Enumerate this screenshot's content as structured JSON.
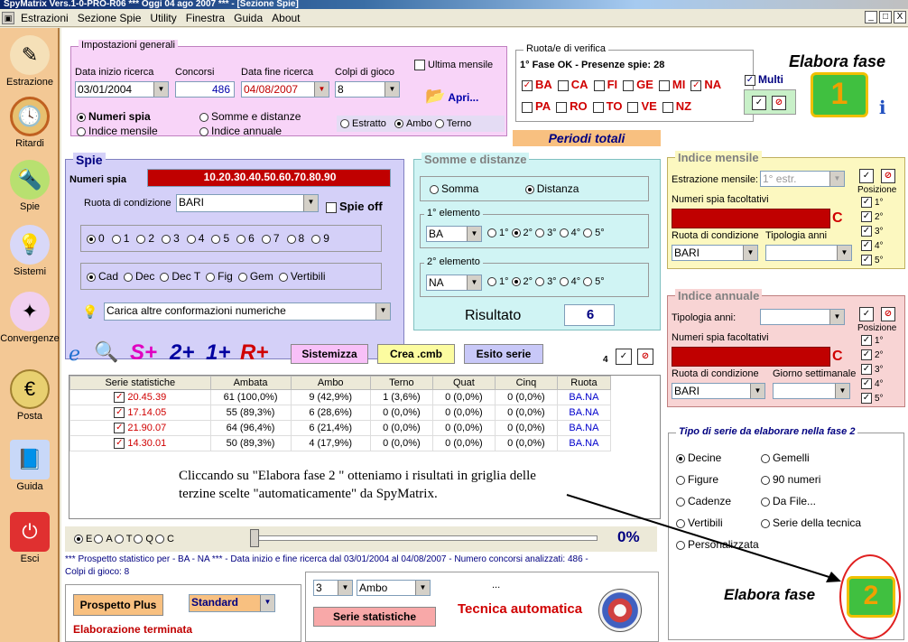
{
  "window": {
    "title": "SpyMatrix Vers.1-0-PRO-R06   ***   Oggi 04 ago 2007   ***   - [Sezione Spie]",
    "menu": [
      "Estrazioni",
      "Sezione Spie",
      "Utility",
      "Finestra",
      "Guida",
      "About"
    ],
    "controls": [
      "_",
      "□",
      "X"
    ]
  },
  "sidebar": [
    {
      "label": "Estrazione",
      "icon": "pencil-icon"
    },
    {
      "label": "Ritardi",
      "icon": "clock-icon"
    },
    {
      "label": "Spie",
      "icon": "flashlight-icon"
    },
    {
      "label": "Sistemi",
      "icon": "lightbulb-icon"
    },
    {
      "label": "Convergenze",
      "icon": "network-icon"
    },
    {
      "label": "Posta",
      "icon": "coin-icon"
    },
    {
      "label": "Guida",
      "icon": "book-icon"
    },
    {
      "label": "Esci",
      "icon": "power-icon"
    }
  ],
  "impostazioni": {
    "title": "Impostazioni generali",
    "data_inizio_label": "Data inizio ricerca",
    "data_inizio": "03/01/2004",
    "concorsi_label": "Concorsi",
    "concorsi": "486",
    "data_fine_label": "Data fine ricerca",
    "data_fine": "04/08/2007",
    "colpi_label": "Colpi di gioco",
    "colpi": "8",
    "ultima_mensile": "Ultima mensile",
    "apri": "Apri...",
    "modes": [
      "Numeri spia",
      "Indice mensile",
      "Somme e distanze",
      "Indice annuale"
    ],
    "sorte": [
      "Estratto",
      "Ambo",
      "Terno"
    ]
  },
  "ruote": {
    "title": "Ruota/e di verifica",
    "status": "1° Fase OK - Presenze spie: 28",
    "row1": [
      {
        "name": "BA",
        "checked": true
      },
      {
        "name": "CA",
        "checked": false
      },
      {
        "name": "FI",
        "checked": false
      },
      {
        "name": "GE",
        "checked": false
      },
      {
        "name": "MI",
        "checked": false
      },
      {
        "name": "NA",
        "checked": true
      }
    ],
    "row2": [
      {
        "name": "PA",
        "checked": false
      },
      {
        "name": "RO",
        "checked": false
      },
      {
        "name": "TO",
        "checked": false
      },
      {
        "name": "VE",
        "checked": false
      },
      {
        "name": "NZ",
        "checked": false
      }
    ],
    "multi": "Multi"
  },
  "elabora1": {
    "label": "Elabora fase",
    "number": "1"
  },
  "periodi": "Periodi totali",
  "spie": {
    "title": "Spie",
    "numeri_label": "Numeri spia",
    "numeri": "10.20.30.40.50.60.70.80.90",
    "ruota_label": "Ruota di condizione",
    "ruota": "BARI",
    "spie_off": "Spie off",
    "digits": [
      "0",
      "1",
      "2",
      "3",
      "4",
      "5",
      "6",
      "7",
      "8",
      "9"
    ],
    "types": [
      "Cad",
      "Dec",
      "Dec T",
      "Fig",
      "Gem",
      "Vertibili"
    ],
    "carica": "Carica altre conformazioni numeriche"
  },
  "somme": {
    "title": "Somme e distanze",
    "somma": "Somma",
    "distanza": "Distanza",
    "el1_label": "1° elemento",
    "el1_ruota": "BA",
    "el2_label": "2° elemento",
    "el2_ruota": "NA",
    "positions": [
      "1°",
      "2°",
      "3°",
      "4°",
      "5°"
    ],
    "risultato_label": "Risultato",
    "risultato": "6"
  },
  "mensile": {
    "title": "Indice mensile",
    "estr_label": "Estrazione mensile:",
    "estr": "1° estr.",
    "facolt": "Numeri spia facoltativi",
    "ruota_label": "Ruota di condizione",
    "tipologia_label": "Tipologia anni",
    "ruota": "BARI",
    "posizione": "Posizione",
    "positions": [
      "1°",
      "2°",
      "3°",
      "4°",
      "5°"
    ],
    "c": "C"
  },
  "annuale": {
    "title": "Indice annuale",
    "tipologia_label": "Tipologia anni:",
    "facolt": "Numeri spia facoltativi",
    "ruota_label": "Ruota di condizione",
    "giorno_label": "Giorno settimanale",
    "ruota": "BARI",
    "posizione": "Posizione",
    "positions": [
      "1°",
      "2°",
      "3°",
      "4°",
      "5°"
    ],
    "c": "C"
  },
  "toolbar": {
    "s_plus": "S+",
    "two_plus": "2+",
    "one_plus": "1+",
    "r_plus": "R+",
    "sistemizza": "Sistemizza",
    "crea": "Crea .cmb",
    "esito": "Esito serie",
    "count": "4"
  },
  "grid": {
    "headers": [
      "Serie statistiche",
      "Ambata",
      "Ambo",
      "Terno",
      "Quat",
      "Cinq",
      "Ruota"
    ],
    "rows": [
      [
        "20.45.39",
        "61 (100,0%)",
        "9 (42,9%)",
        "1 (3,6%)",
        "0 (0,0%)",
        "0 (0,0%)",
        "BA.NA"
      ],
      [
        "17.14.05",
        "55 (89,3%)",
        "6 (28,6%)",
        "0 (0,0%)",
        "0 (0,0%)",
        "0 (0,0%)",
        "BA.NA"
      ],
      [
        "21.90.07",
        "64 (96,4%)",
        "6 (21,4%)",
        "0 (0,0%)",
        "0 (0,0%)",
        "0 (0,0%)",
        "BA.NA"
      ],
      [
        "14.30.01",
        "50 (89,3%)",
        "4 (17,9%)",
        "0 (0,0%)",
        "0 (0,0%)",
        "0 (0,0%)",
        "BA.NA"
      ]
    ]
  },
  "annotation": {
    "line1": "Cliccando su \"Elabora fase 2 \" otteniamo i risultati in griglia delle",
    "line2": "terzine scelte \"automaticamente\" da SpyMatrix."
  },
  "progress": {
    "options": [
      "E",
      "A",
      "T",
      "Q",
      "C"
    ],
    "value": "0%",
    "fraction": 0
  },
  "prospetto": {
    "line1": "*** Prospetto statistico per  - BA - NA ***  - Data inizio e fine ricerca dal 03/01/2004 al 04/08/2007 - Numero concorsi analizzati: 486 -",
    "line2": "Colpi di gioco: 8"
  },
  "bottom": {
    "prospetto_plus": "Prospetto Plus",
    "standard": "Standard",
    "terminata": "Elaborazione terminata",
    "num": "3",
    "sorte": "Ambo",
    "serie": "Serie statistiche",
    "tecnica": "Tecnica automatica",
    "dots": "..."
  },
  "tipo": {
    "title": "Tipo di serie da elaborare nella fase 2",
    "options": [
      "Decine",
      "Gemelli",
      "Figure",
      "90 numeri",
      "Cadenze",
      "Da File...",
      "Vertibili",
      "Serie della tecnica",
      "Personalizzata"
    ]
  },
  "elabora2": {
    "label": "Elabora fase",
    "number": "2"
  }
}
